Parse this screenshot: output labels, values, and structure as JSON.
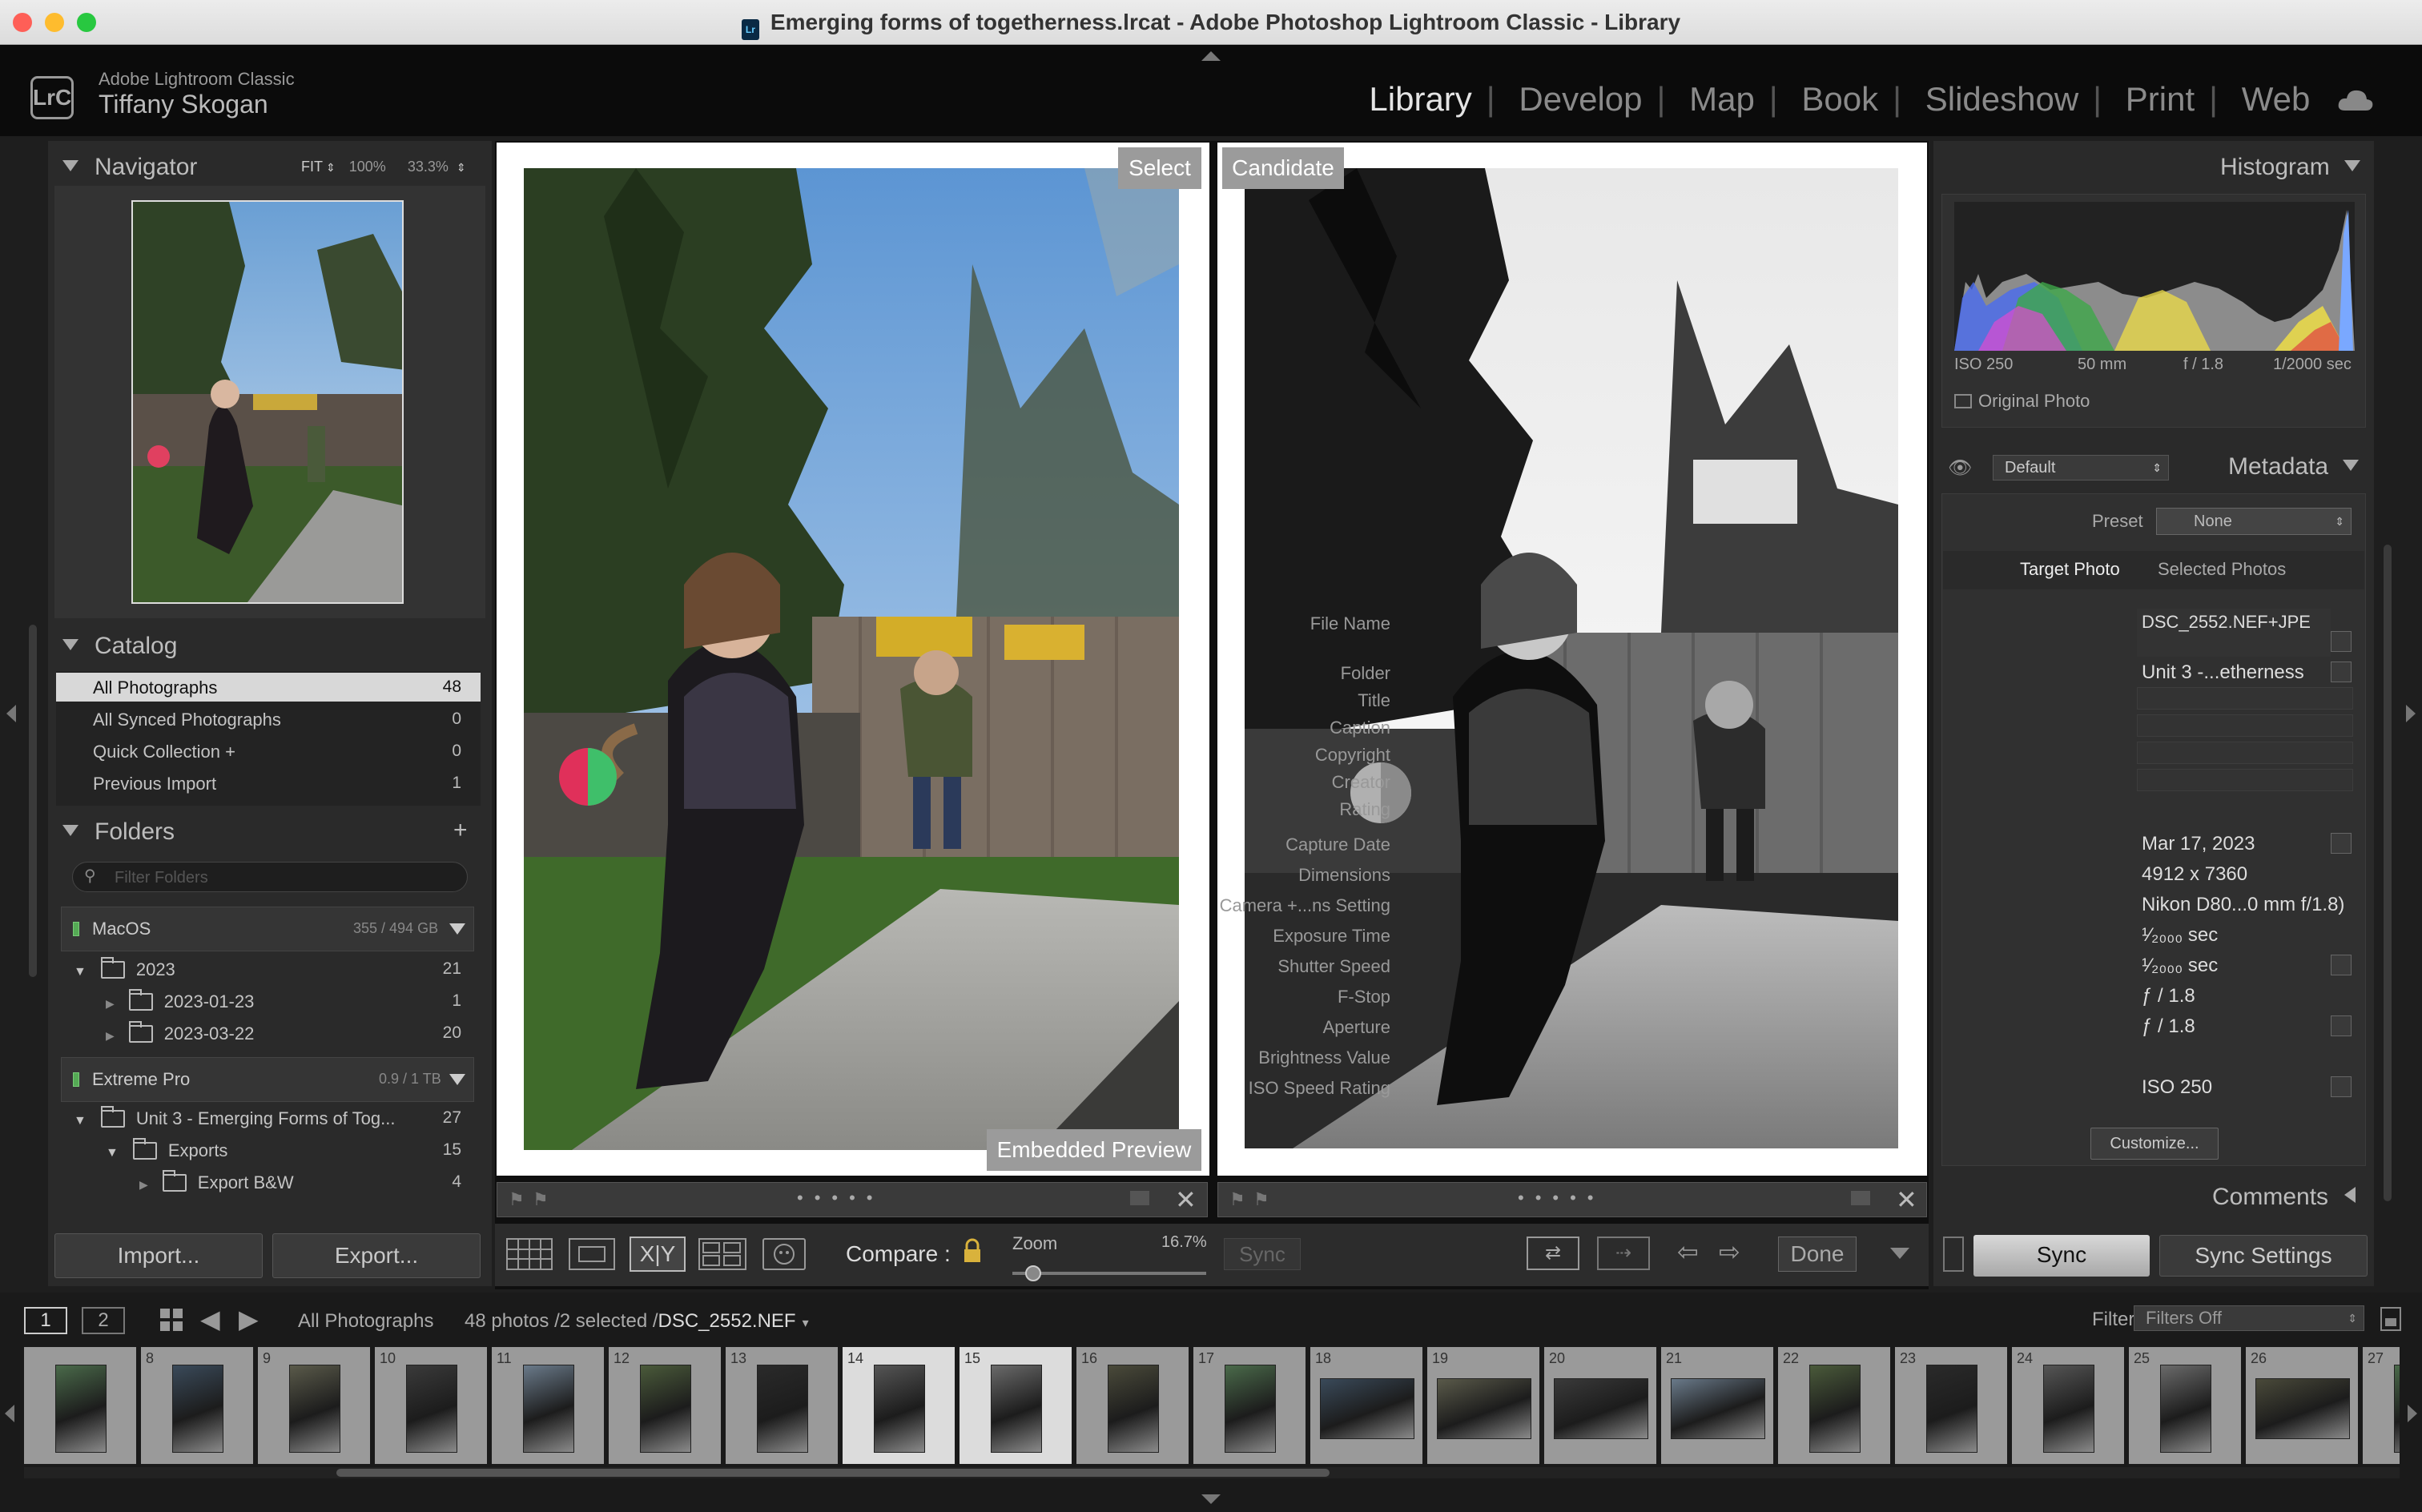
{
  "window": {
    "title": "Emerging forms of togetherness.lrcat - Adobe Photoshop Lightroom Classic - Library"
  },
  "identity": {
    "logo": "LrC",
    "product": "Adobe Lightroom Classic",
    "user": "Tiffany Skogan"
  },
  "modules": [
    "Library",
    "Develop",
    "Map",
    "Book",
    "Slideshow",
    "Print",
    "Web"
  ],
  "navigator": {
    "title": "Navigator",
    "zoom": [
      "FIT",
      "100%",
      "33.3%"
    ]
  },
  "catalog": {
    "title": "Catalog",
    "items": [
      {
        "label": "All Photographs",
        "count": "48"
      },
      {
        "label": "All Synced Photographs",
        "count": "0"
      },
      {
        "label": "Quick Collection +",
        "count": "0"
      },
      {
        "label": "Previous Import",
        "count": "1"
      }
    ]
  },
  "folders": {
    "title": "Folders",
    "filter_placeholder": "Filter Folders",
    "volumes": [
      {
        "name": "MacOS",
        "usage": "355 / 494 GB"
      },
      {
        "name": "Extreme Pro",
        "usage": "0.9 / 1 TB"
      }
    ],
    "items": [
      {
        "label": "2023",
        "count": "21"
      },
      {
        "label": "2023-01-23",
        "count": "1"
      },
      {
        "label": "2023-03-22",
        "count": "20"
      },
      {
        "label": "Unit 3 - Emerging Forms of Tog...",
        "count": "27"
      },
      {
        "label": "Exports",
        "count": "15"
      },
      {
        "label": "Export B&W",
        "count": "4"
      }
    ]
  },
  "left_buttons": {
    "import": "Import...",
    "export": "Export..."
  },
  "compare": {
    "select_label": "Select",
    "candidate_label": "Candidate",
    "overlay": "Embedded Preview",
    "toolbar_label": "Compare :",
    "zoom_label": "Zoom",
    "zoom_value": "16.7%",
    "sync": "Sync",
    "done": "Done"
  },
  "histogram": {
    "title": "Histogram",
    "iso": "ISO 250",
    "focal": "50 mm",
    "fstop": "f / 1.8",
    "shutter": "1/2000 sec",
    "original": "Original Photo"
  },
  "metadata": {
    "title": "Metadata",
    "preset_set": "Default",
    "preset_label": "Preset",
    "preset_value": "None",
    "tabs": [
      "Target Photo",
      "Selected Photos"
    ],
    "fields": [
      {
        "label": "File Name",
        "value": "DSC_2552.NEF+JPE"
      },
      {
        "label": "Folder",
        "value": "Unit 3 -...etherness"
      },
      {
        "label": "Title",
        "value": ""
      },
      {
        "label": "Caption",
        "value": ""
      },
      {
        "label": "Copyright",
        "value": ""
      },
      {
        "label": "Creator",
        "value": ""
      },
      {
        "label": "Rating",
        "value": ""
      },
      {
        "label": "Capture Date",
        "value": "Mar 17, 2023"
      },
      {
        "label": "Dimensions",
        "value": "4912 x 7360"
      },
      {
        "label": "Camera +...ns Setting",
        "value": "Nikon D80...0 mm f/1.8)"
      },
      {
        "label": "Exposure Time",
        "value": "¹⁄₂₀₀₀ sec"
      },
      {
        "label": "Shutter Speed",
        "value": "¹⁄₂₀₀₀ sec"
      },
      {
        "label": "F-Stop",
        "value": "ƒ / 1.8"
      },
      {
        "label": "Aperture",
        "value": "ƒ / 1.8"
      },
      {
        "label": "Brightness Value",
        "value": ""
      },
      {
        "label": "ISO Speed Rating",
        "value": "ISO 250"
      }
    ],
    "customize": "Customize..."
  },
  "comments": {
    "title": "Comments"
  },
  "right_buttons": {
    "sync": "Sync",
    "sync_settings": "Sync Settings"
  },
  "filmstrip": {
    "views": [
      "1",
      "2"
    ],
    "source": "All Photographs",
    "count": "48 photos /2 selected /",
    "filename": "DSC_2552.NEF",
    "filter_label": "Filter :",
    "filter_value": "Filters Off",
    "numbers": [
      "",
      "8",
      "9",
      "10",
      "11",
      "12",
      "13",
      "14",
      "15",
      "16",
      "17",
      "18",
      "19",
      "20",
      "21",
      "22",
      "23",
      "24",
      "25",
      "26",
      "27"
    ]
  },
  "colors": {
    "accent": "#e4e4e4",
    "bg": "#1e1e1e",
    "panel": "#2a2a2a"
  }
}
